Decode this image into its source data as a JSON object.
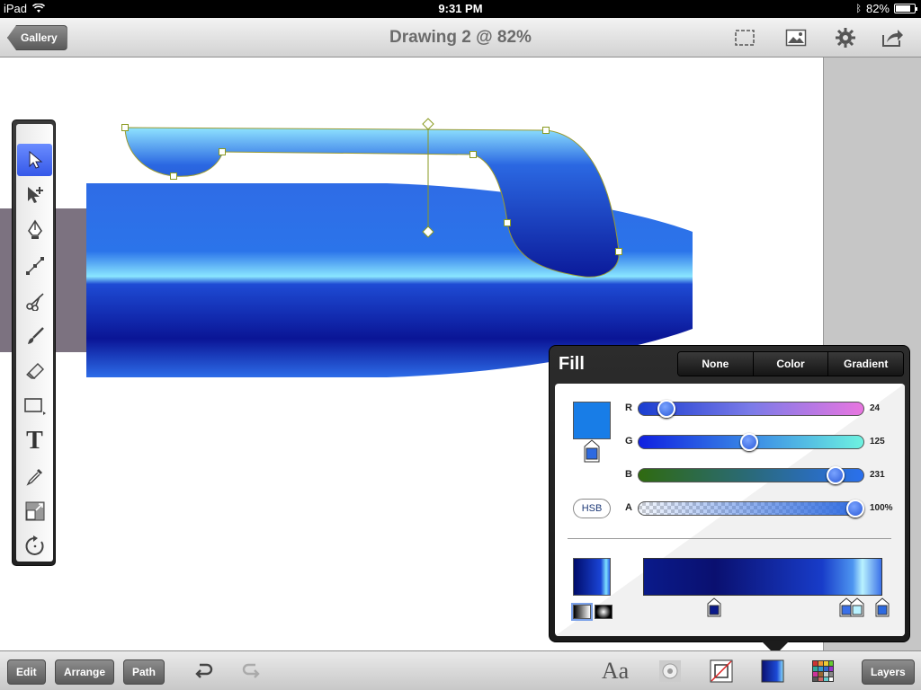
{
  "status": {
    "device": "iPad",
    "time": "9:31 PM",
    "battery": "82%",
    "battery_level": 0.82
  },
  "navbar": {
    "back_label": "Gallery",
    "title": "Drawing 2 @ 82%",
    "icons": [
      "fullscreen-icon",
      "image-icon",
      "gear-icon",
      "share-icon"
    ]
  },
  "tools": [
    "select-arrow-icon",
    "node-select-icon",
    "pen-icon",
    "add-node-icon",
    "scissors-icon",
    "brush-icon",
    "eraser-icon",
    "rectangle-icon",
    "text-icon",
    "eyedropper-icon",
    "transform-icon",
    "rotate-icon"
  ],
  "fill": {
    "title": "Fill",
    "tabs": [
      "None",
      "Color",
      "Gradient"
    ],
    "selected_tab": "Gradient",
    "hsb_label": "HSB",
    "channels": [
      {
        "label": "R",
        "value": "24",
        "fraction": 0.094
      },
      {
        "label": "G",
        "value": "125",
        "fraction": 0.49
      },
      {
        "label": "B",
        "value": "231",
        "fraction": 0.906
      },
      {
        "label": "A",
        "value": "100%",
        "fraction": 1.0
      }
    ],
    "current_color": "#187de7"
  },
  "bottom": {
    "edit": "Edit",
    "arrange": "Arrange",
    "path": "Path",
    "text_tool": "Aa",
    "layers": "Layers",
    "icons": [
      "undo-icon",
      "redo-icon",
      "text-style-icon",
      "shadow-icon",
      "stroke-icon",
      "fill-icon",
      "swatches-icon"
    ]
  }
}
